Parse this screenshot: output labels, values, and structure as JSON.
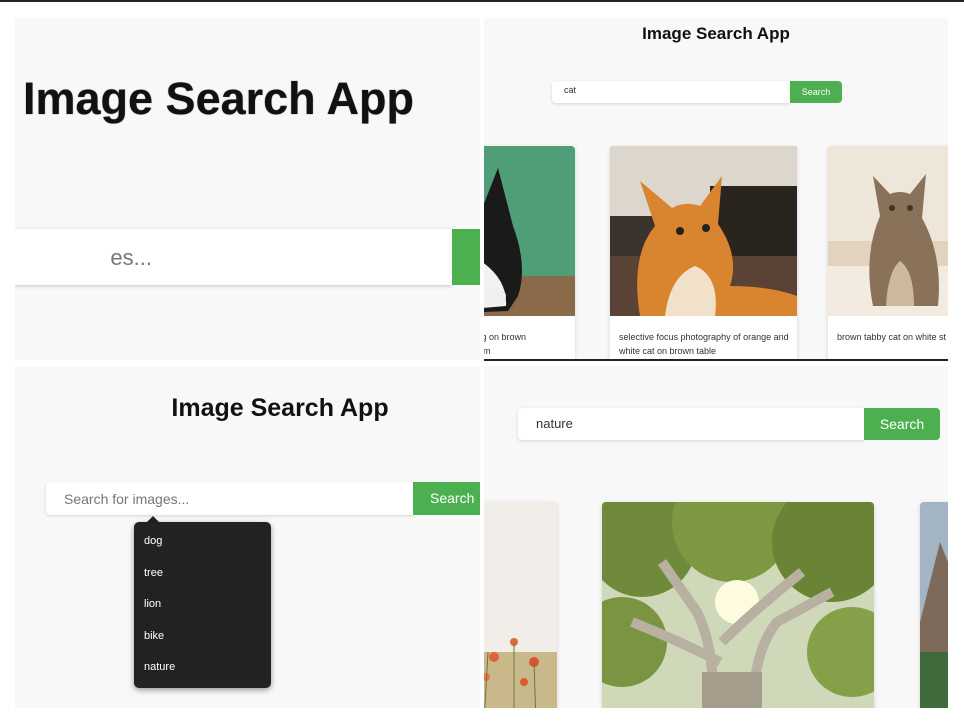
{
  "app_title": "Image Search App",
  "panel_zoom": {
    "placeholder_fragment": "es..."
  },
  "panel_cat": {
    "query": "cat",
    "button": "Search",
    "results": [
      {
        "caption": "ying on brown\nroom"
      },
      {
        "caption": "selective focus photography of orange and white cat on brown table"
      },
      {
        "caption": "brown tabby cat on white st"
      }
    ]
  },
  "panel_suggest": {
    "placeholder": "Search for images...",
    "button": "Search",
    "suggestions": [
      "dog",
      "tree",
      "lion",
      "bike",
      "nature"
    ]
  },
  "panel_nature": {
    "query": "nature",
    "button": "Search"
  },
  "colors": {
    "accent": "#4caf50",
    "panel_bg": "#f8f8f8",
    "dropdown_bg": "#222222"
  }
}
